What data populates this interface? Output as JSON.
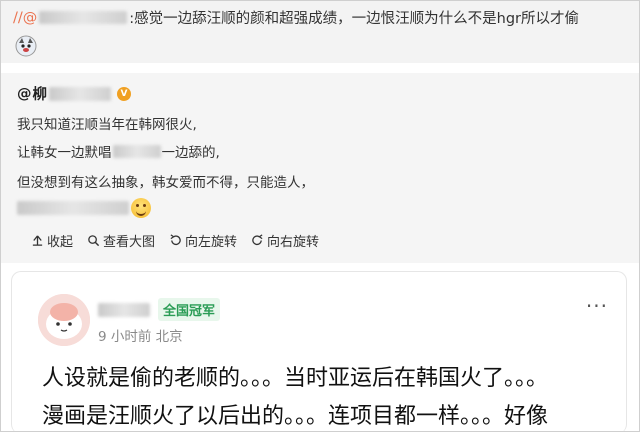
{
  "repost": {
    "prefix": "//@",
    "text": ":感觉一边舔汪顺的颜和超强成绩，一边恨汪顺为什么不是hgr所以才偷"
  },
  "original": {
    "author_prefix": "@",
    "lines": [
      "我只知道汪顺当年在韩网很火,",
      "让韩女一边默唱",
      "一边舔的,",
      "但没想到有这么抽象，韩女爱而不得，只能造人，"
    ],
    "toolbar": [
      {
        "icon": "collapse-icon",
        "label": "收起"
      },
      {
        "icon": "zoom-icon",
        "label": "查看大图"
      },
      {
        "icon": "rotate-left-icon",
        "label": "向左旋转"
      },
      {
        "icon": "rotate-right-icon",
        "label": "向右旋转"
      }
    ]
  },
  "comment": {
    "badge": "全国冠军",
    "meta": "9 小时前  北京",
    "more": "···",
    "lines": [
      "人设就是偷的老顺的。。。当时亚运后在韩国火了。。。",
      "漫画是汪顺火了以后出的。。。连项目都一样。。。好像"
    ]
  }
}
